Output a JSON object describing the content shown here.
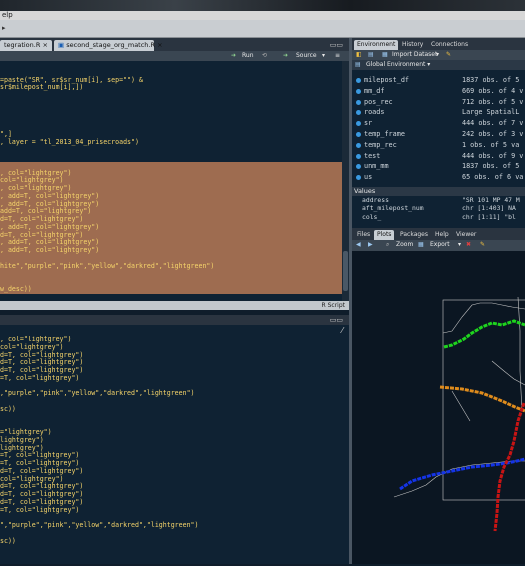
{
  "menubar": {
    "help": "elp"
  },
  "editor": {
    "tabs": [
      {
        "label": "tegration.R"
      },
      {
        "label": "second_stage_org_match.R"
      }
    ],
    "run": "Run",
    "source": "Source",
    "lines": [
      {
        "t": "",
        "h": false
      },
      {
        "t": "",
        "h": false
      },
      {
        "t": "=paste(\"SR\", sr$sr_num[i], sep=\"\") &",
        "h": false
      },
      {
        "t": "sr$milepost_num[i],])",
        "h": false
      },
      {
        "t": "",
        "h": false
      },
      {
        "t": "",
        "h": false
      },
      {
        "t": "",
        "h": false
      },
      {
        "t": "",
        "h": false
      },
      {
        "t": "",
        "h": false
      },
      {
        "t": "\",]",
        "h": false
      },
      {
        "t": ", layer = \"tl_2013_04_prisecroads\")",
        "h": false
      },
      {
        "t": "",
        "h": false
      },
      {
        "t": "",
        "h": false
      },
      {
        "t": "",
        "h": true
      },
      {
        "t": ", col=\"lightgrey\")",
        "h": true
      },
      {
        "t": "col=\"lightgrey\")",
        "h": true
      },
      {
        "t": ", col=\"lightgrey\")",
        "h": true
      },
      {
        "t": ", add=T, col=\"lightgrey\")",
        "h": true
      },
      {
        "t": ", add=T, col=\"lightgrey\")",
        "h": true
      },
      {
        "t": "add=T, col=\"lightgrey\")",
        "h": true
      },
      {
        "t": "d=T, col=\"lightgrey\")",
        "h": true
      },
      {
        "t": ", add=T, col=\"lightgrey\")",
        "h": true
      },
      {
        "t": "d=T, col=\"lightgrey\")",
        "h": true
      },
      {
        "t": ", add=T, col=\"lightgrey\")",
        "h": true
      },
      {
        "t": ", add=T, col=\"lightgrey\")",
        "h": true
      },
      {
        "t": "",
        "h": true
      },
      {
        "t": "hite\",\"purple\",\"pink\",\"yellow\",\"darkred\",\"lightgreen\")",
        "h": true
      },
      {
        "t": "",
        "h": true
      },
      {
        "t": "",
        "h": true
      },
      {
        "t": "w_desc))",
        "h": true
      },
      {
        "t": "",
        "h": false
      }
    ],
    "status": "R Script"
  },
  "console": {
    "lines": [
      {
        "t": ", col=\"lightgrey\")"
      },
      {
        "t": "col=\"lightgrey\")"
      },
      {
        "t": "d=T, col=\"lightgrey\")"
      },
      {
        "t": "d=T, col=\"lightgrey\")"
      },
      {
        "t": "d=T, col=\"lightgrey\")"
      },
      {
        "t": "=T, col=\"lightgrey\")"
      },
      {
        "t": ""
      },
      {
        "t": ",\"purple\",\"pink\",\"yellow\",\"darkred\",\"lightgreen\")"
      },
      {
        "t": ""
      },
      {
        "t": "sc))"
      },
      {
        "t": ""
      },
      {
        "t": ""
      },
      {
        "t": "=\"lightgrey\")"
      },
      {
        "t": "lightgrey\")"
      },
      {
        "t": "lightgrey\")"
      },
      {
        "t": "=T, col=\"lightgrey\")"
      },
      {
        "t": "=T, col=\"lightgrey\")"
      },
      {
        "t": "d=T, col=\"lightgrey\")"
      },
      {
        "t": "col=\"lightgrey\")"
      },
      {
        "t": "d=T, col=\"lightgrey\")"
      },
      {
        "t": "d=T, col=\"lightgrey\")"
      },
      {
        "t": "d=T, col=\"lightgrey\")"
      },
      {
        "t": "=T, col=\"lightgrey\")"
      },
      {
        "t": ""
      },
      {
        "t": "\",\"purple\",\"pink\",\"yellow\",\"darkred\",\"lightgreen\")"
      },
      {
        "t": ""
      },
      {
        "t": "sc))"
      }
    ]
  },
  "env": {
    "tabs": [
      "Environment",
      "History",
      "Connections"
    ],
    "import": "Import Dataset",
    "global": "Global Environment",
    "rows": [
      {
        "name": "milepost_df",
        "val": "1837 obs. of 5"
      },
      {
        "name": "mm_df",
        "val": "669 obs. of 4 v"
      },
      {
        "name": "pos_rec",
        "val": "712 obs. of 5 v"
      },
      {
        "name": "roads",
        "val": "Large SpatialL"
      },
      {
        "name": "sr",
        "val": "444 obs. of 7 v"
      },
      {
        "name": "temp_frame",
        "val": "242 obs. of 3 v"
      },
      {
        "name": "temp_rec",
        "val": "1 obs. of 5 va"
      },
      {
        "name": "test",
        "val": "444 obs. of 9 v"
      },
      {
        "name": "unm_mm",
        "val": "1837 obs. of 5"
      },
      {
        "name": "us",
        "val": "65 obs. of 6 va"
      }
    ],
    "values_header": "Values",
    "values": [
      {
        "name": "address",
        "val": "\"SR 101 MP 47 M"
      },
      {
        "name": "aft_milepost_num",
        "val": "chr [1:403] NA"
      },
      {
        "name": "cols_",
        "val": "chr [1:11] \"bl"
      }
    ]
  },
  "files": {
    "tabs": [
      "Files",
      "Plots",
      "Packages",
      "Help",
      "Viewer"
    ],
    "zoom": "Zoom",
    "export": "Export"
  },
  "colors": {
    "highlight": "#9e6c50",
    "code_text": "#f5d46a",
    "route_green": "#1ed41e",
    "route_orange": "#e08c1c",
    "route_blue": "#1434e8",
    "route_red": "#c81414"
  }
}
